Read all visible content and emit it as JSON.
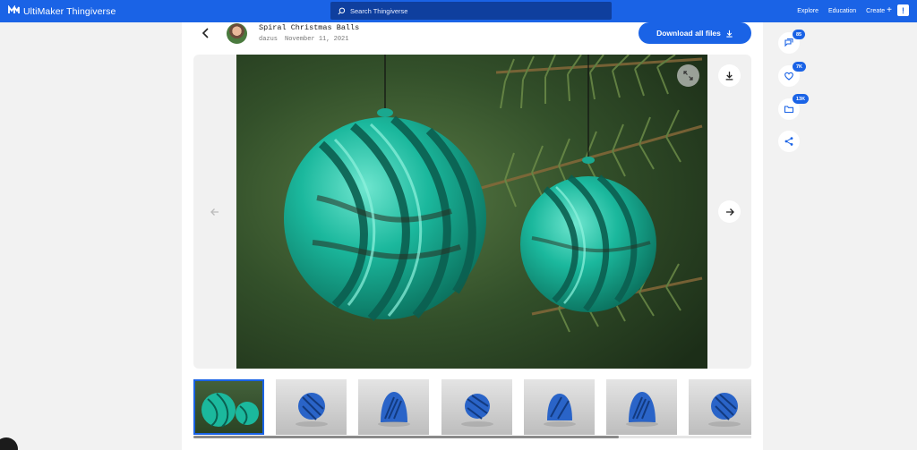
{
  "header": {
    "brand": "UltiMaker Thingiverse",
    "search_placeholder": "Search Thingiverse",
    "nav": {
      "explore": "Explore",
      "education": "Education",
      "create": "Create"
    },
    "alert_label": "!"
  },
  "thing": {
    "title": "Spiral Christmas Balls",
    "author": "dazus",
    "date": "November 11, 2021",
    "download_label": "Download all files"
  },
  "side_actions": {
    "comments_count": "85",
    "likes_count": "7K",
    "collections_count": "13K"
  },
  "colors": {
    "brand_blue": "#1a63e6",
    "ornament_teal": "#18b59b",
    "thumb_blue": "#2a64c8"
  },
  "gallery": {
    "thumbnail_count": 7,
    "active_index": 0
  }
}
